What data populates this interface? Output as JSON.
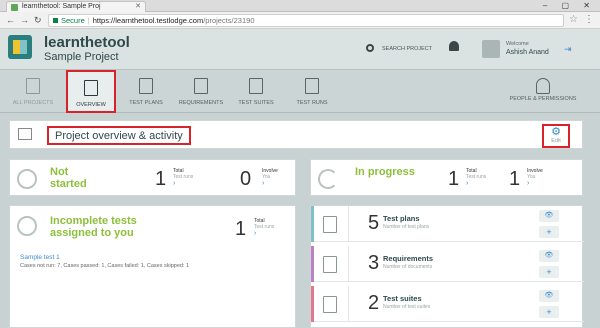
{
  "browser": {
    "tab_title": "learnthetool: Sample Proj",
    "secure_label": "Secure",
    "url_host": "https://learnthetool.testlodge.com",
    "url_path": "/projects/23190"
  },
  "header": {
    "app_name": "learnthetool",
    "project_name": "Sample Project",
    "search_label": "SEARCH PROJECT",
    "welcome_label": "Welcome",
    "user_name": "Ashish Anand"
  },
  "nav": {
    "items": [
      {
        "label": "ALL PROJECTS"
      },
      {
        "label": "OVERVIEW"
      },
      {
        "label": "TEST PLANS"
      },
      {
        "label": "REQUIREMENTS"
      },
      {
        "label": "TEST SUITES"
      },
      {
        "label": "TEST RUNS"
      },
      {
        "label": "PEOPLE & PERMISSIONS"
      }
    ]
  },
  "overview": {
    "title": "Project overview & activity",
    "edit_label": "Edit"
  },
  "stats": {
    "not_started": {
      "title": "Not started",
      "count": "1",
      "total_label": "Total",
      "total_sub": "Test runs",
      "involve_count": "0",
      "involve_label": "Involve",
      "involve_sub": "You"
    },
    "in_progress": {
      "title": "In progress",
      "count": "1",
      "total_label": "Total",
      "total_sub": "Test runs",
      "involve_count": "1",
      "involve_label": "Involve",
      "involve_sub": "You"
    }
  },
  "incomplete": {
    "title": "Incomplete tests assigned to you",
    "count": "1",
    "total_label": "Total",
    "total_sub": "Test runs",
    "sample_link": "Sample test 1",
    "sample_stats": "Cases not run: 7, Cases passed: 1, Cases failed: 1, Cases skipped: 1"
  },
  "summary": {
    "items": [
      {
        "count": "5",
        "label": "Test plans",
        "sub": "Number of test plans"
      },
      {
        "count": "3",
        "label": "Requirements",
        "sub": "Number of documents"
      },
      {
        "count": "2",
        "label": "Test suites",
        "sub": "Number of test suites"
      }
    ]
  },
  "colors": {
    "accent_green": "#8dbf3a",
    "link_blue": "#3d8bd0",
    "highlight_red": "#d8232a"
  }
}
